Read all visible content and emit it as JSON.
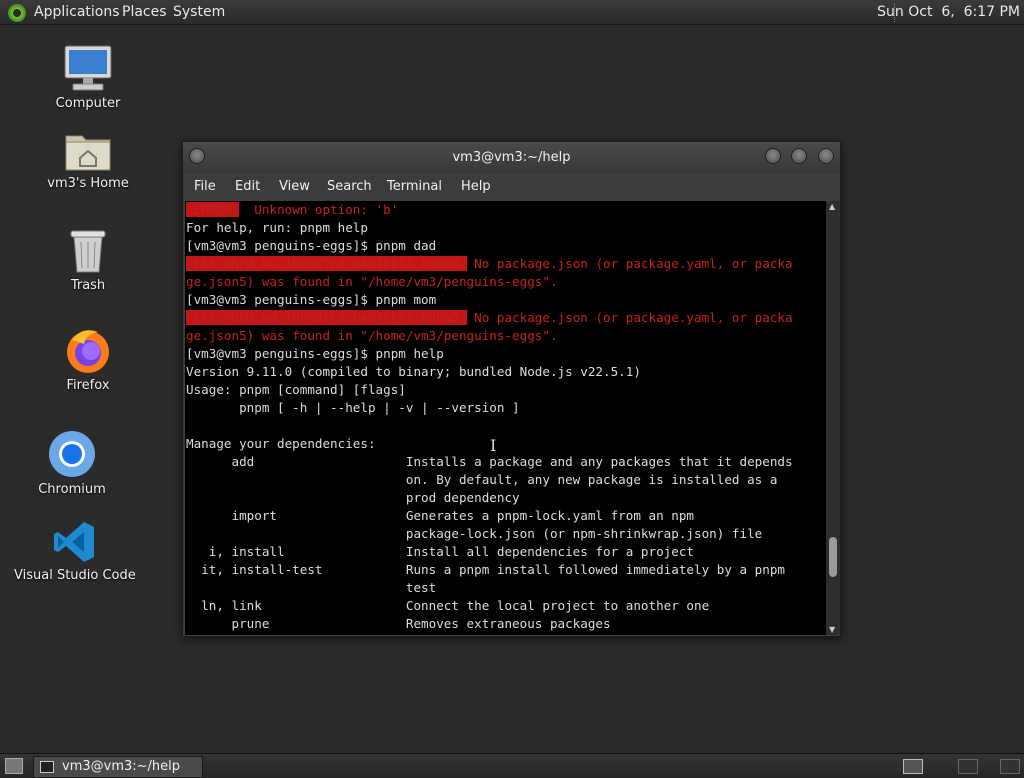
{
  "top_panel": {
    "menus": [
      "Applications",
      "Places",
      "System"
    ],
    "clock": "Sun Oct  6,  6:17 PM"
  },
  "desktop_icons": [
    {
      "label": "Computer",
      "icon": "computer-icon"
    },
    {
      "label": "vm3's Home",
      "icon": "home-folder-icon"
    },
    {
      "label": "Trash",
      "icon": "trash-icon"
    },
    {
      "label": "Firefox",
      "icon": "firefox-icon"
    },
    {
      "label": "Chromium",
      "icon": "chromium-icon"
    },
    {
      "label": "Visual Studio Code",
      "icon": "vscode-icon"
    }
  ],
  "terminal": {
    "title": "vm3@vm3:~/help",
    "menu": [
      "File",
      "Edit",
      "View",
      "Search",
      "Terminal",
      "Help"
    ],
    "lines": [
      {
        "parts": [
          {
            "t": " ERROR ",
            "c": "errbg"
          },
          {
            "t": "  Unknown option: 'b'",
            "c": "err"
          }
        ]
      },
      {
        "parts": [
          {
            "t": "For help, run: pnpm help",
            "c": ""
          }
        ]
      },
      {
        "parts": [
          {
            "t": "[vm3@vm3 penguins-eggs]$ pnpm dad",
            "c": ""
          }
        ]
      },
      {
        "parts": [
          {
            "t": " ERR_PNPM_NO_IMPORTER_MANIFEST_FOUND ",
            "c": "errbg"
          },
          {
            "t": " No package.json (or package.yaml, or packa",
            "c": "err"
          }
        ]
      },
      {
        "parts": [
          {
            "t": "ge.json5) was found in \"/home/vm3/penguins-eggs\".",
            "c": "err"
          }
        ]
      },
      {
        "parts": [
          {
            "t": "[vm3@vm3 penguins-eggs]$ pnpm mom",
            "c": ""
          }
        ]
      },
      {
        "parts": [
          {
            "t": " ERR_PNPM_NO_IMPORTER_MANIFEST_FOUND ",
            "c": "errbg"
          },
          {
            "t": " No package.json (or package.yaml, or packa",
            "c": "err"
          }
        ]
      },
      {
        "parts": [
          {
            "t": "ge.json5) was found in \"/home/vm3/penguins-eggs\".",
            "c": "err"
          }
        ]
      },
      {
        "parts": [
          {
            "t": "[vm3@vm3 penguins-eggs]$ pnpm help",
            "c": ""
          }
        ]
      },
      {
        "parts": [
          {
            "t": "Version 9.11.0 (compiled to binary; bundled Node.js v22.5.1)",
            "c": ""
          }
        ]
      },
      {
        "parts": [
          {
            "t": "Usage: pnpm [command] [flags]",
            "c": ""
          }
        ]
      },
      {
        "parts": [
          {
            "t": "       pnpm [ -h | --help | -v | --version ]",
            "c": ""
          }
        ]
      },
      {
        "parts": [
          {
            "t": "",
            "c": ""
          }
        ]
      },
      {
        "parts": [
          {
            "t": "Manage your dependencies:",
            "c": ""
          }
        ]
      },
      {
        "parts": [
          {
            "t": "      add                    Installs a package and any packages that it depends",
            "c": ""
          }
        ]
      },
      {
        "parts": [
          {
            "t": "                             on. By default, any new package is installed as a",
            "c": ""
          }
        ]
      },
      {
        "parts": [
          {
            "t": "                             prod dependency",
            "c": ""
          }
        ]
      },
      {
        "parts": [
          {
            "t": "      import                 Generates a pnpm-lock.yaml from an npm",
            "c": ""
          }
        ]
      },
      {
        "parts": [
          {
            "t": "                             package-lock.json (or npm-shrinkwrap.json) file",
            "c": ""
          }
        ]
      },
      {
        "parts": [
          {
            "t": "   i, install                Install all dependencies for a project",
            "c": ""
          }
        ]
      },
      {
        "parts": [
          {
            "t": "  it, install-test           Runs a pnpm install followed immediately by a pnpm",
            "c": ""
          }
        ]
      },
      {
        "parts": [
          {
            "t": "                             test",
            "c": ""
          }
        ]
      },
      {
        "parts": [
          {
            "t": "  ln, link                   Connect the local project to another one",
            "c": ""
          }
        ]
      },
      {
        "parts": [
          {
            "t": "      prune                  Removes extraneous packages",
            "c": ""
          }
        ]
      }
    ]
  },
  "taskbar": {
    "task_label": "vm3@vm3:~/help"
  }
}
